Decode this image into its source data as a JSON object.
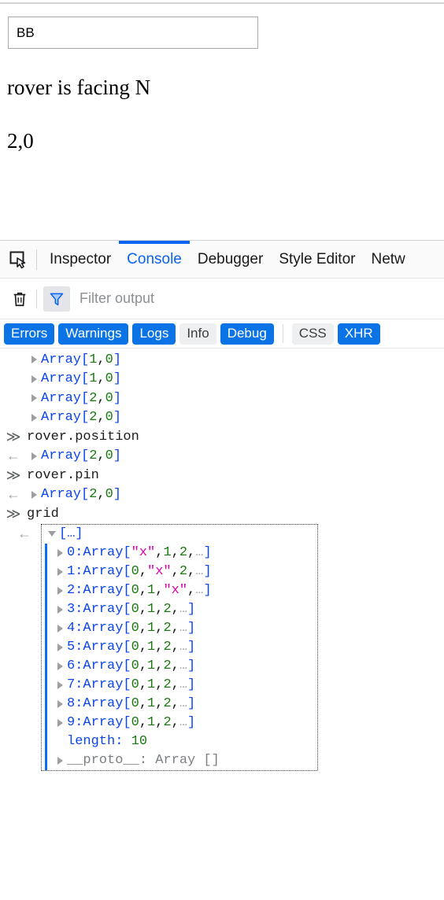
{
  "page": {
    "input_value": "BB",
    "input_placeholder": "",
    "facing_text": "rover is facing N",
    "coords_text": "2,0"
  },
  "devtools": {
    "picker_icon": "element-picker-icon",
    "tabs": [
      {
        "label": "Inspector",
        "active": false
      },
      {
        "label": "Console",
        "active": true
      },
      {
        "label": "Debugger",
        "active": false
      },
      {
        "label": "Style Editor",
        "active": false
      },
      {
        "label": "Netw",
        "active": false
      }
    ],
    "toolbar": {
      "clear_icon": "trash-icon",
      "filter_icon": "funnel-icon",
      "filter_placeholder": "Filter output",
      "filter_value": ""
    },
    "filter_pills": [
      {
        "label": "Errors",
        "active": true
      },
      {
        "label": "Warnings",
        "active": true
      },
      {
        "label": "Logs",
        "active": true
      },
      {
        "label": "Info",
        "active": false
      },
      {
        "label": "Debug",
        "active": true
      },
      {
        "label": "CSS",
        "active": false
      },
      {
        "label": "XHR",
        "active": true
      }
    ],
    "console_rows": [
      {
        "kind": "log",
        "marker": "",
        "preview": "Array",
        "items": [
          "1",
          "0"
        ],
        "types": [
          "num",
          "num"
        ]
      },
      {
        "kind": "log",
        "marker": "",
        "preview": "Array",
        "items": [
          "1",
          "0"
        ],
        "types": [
          "num",
          "num"
        ]
      },
      {
        "kind": "log",
        "marker": "",
        "preview": "Array",
        "items": [
          "2",
          "0"
        ],
        "types": [
          "num",
          "num"
        ]
      },
      {
        "kind": "log",
        "marker": "",
        "preview": "Array",
        "items": [
          "2",
          "0"
        ],
        "types": [
          "num",
          "num"
        ]
      },
      {
        "kind": "input",
        "marker": "≫",
        "text": "rover.position"
      },
      {
        "kind": "output",
        "marker": "←",
        "preview": "Array",
        "items": [
          "2",
          "0"
        ],
        "types": [
          "num",
          "num"
        ]
      },
      {
        "kind": "input",
        "marker": "≫",
        "text": "rover.pin"
      },
      {
        "kind": "output",
        "marker": "←",
        "preview": "Array",
        "items": [
          "2",
          "0"
        ],
        "types": [
          "num",
          "num"
        ]
      },
      {
        "kind": "input",
        "marker": "≫",
        "text": "grid"
      }
    ],
    "grid_object": {
      "marker": "←",
      "header": "[…]",
      "rows": [
        {
          "index": "0:",
          "preview": "Array",
          "items": [
            "\"x\"",
            "1",
            "2",
            "…"
          ],
          "types": [
            "str",
            "num",
            "num",
            "ell"
          ]
        },
        {
          "index": "1:",
          "preview": "Array",
          "items": [
            "0",
            "\"x\"",
            "2",
            "…"
          ],
          "types": [
            "num",
            "str",
            "num",
            "ell"
          ]
        },
        {
          "index": "2:",
          "preview": "Array",
          "items": [
            "0",
            "1",
            "\"x\"",
            "…"
          ],
          "types": [
            "num",
            "num",
            "str",
            "ell"
          ]
        },
        {
          "index": "3:",
          "preview": "Array",
          "items": [
            "0",
            "1",
            "2",
            "…"
          ],
          "types": [
            "num",
            "num",
            "num",
            "ell"
          ]
        },
        {
          "index": "4:",
          "preview": "Array",
          "items": [
            "0",
            "1",
            "2",
            "…"
          ],
          "types": [
            "num",
            "num",
            "num",
            "ell"
          ]
        },
        {
          "index": "5:",
          "preview": "Array",
          "items": [
            "0",
            "1",
            "2",
            "…"
          ],
          "types": [
            "num",
            "num",
            "num",
            "ell"
          ]
        },
        {
          "index": "6:",
          "preview": "Array",
          "items": [
            "0",
            "1",
            "2",
            "…"
          ],
          "types": [
            "num",
            "num",
            "num",
            "ell"
          ]
        },
        {
          "index": "7:",
          "preview": "Array",
          "items": [
            "0",
            "1",
            "2",
            "…"
          ],
          "types": [
            "num",
            "num",
            "num",
            "ell"
          ]
        },
        {
          "index": "8:",
          "preview": "Array",
          "items": [
            "0",
            "1",
            "2",
            "…"
          ],
          "types": [
            "num",
            "num",
            "num",
            "ell"
          ]
        },
        {
          "index": "9:",
          "preview": "Array",
          "items": [
            "0",
            "1",
            "2",
            "…"
          ],
          "types": [
            "num",
            "num",
            "num",
            "ell"
          ]
        }
      ],
      "length_key": "length:",
      "length_value": "10",
      "proto_label": "__proto__: Array []"
    }
  },
  "colors": {
    "accent_blue": "#0a62f0",
    "pill_blue": "#0a74e6",
    "value_green": "#1a7a12",
    "string_magenta": "#dd00a9",
    "array_blue": "#0b45f0",
    "proto_gray": "#7c8084"
  }
}
